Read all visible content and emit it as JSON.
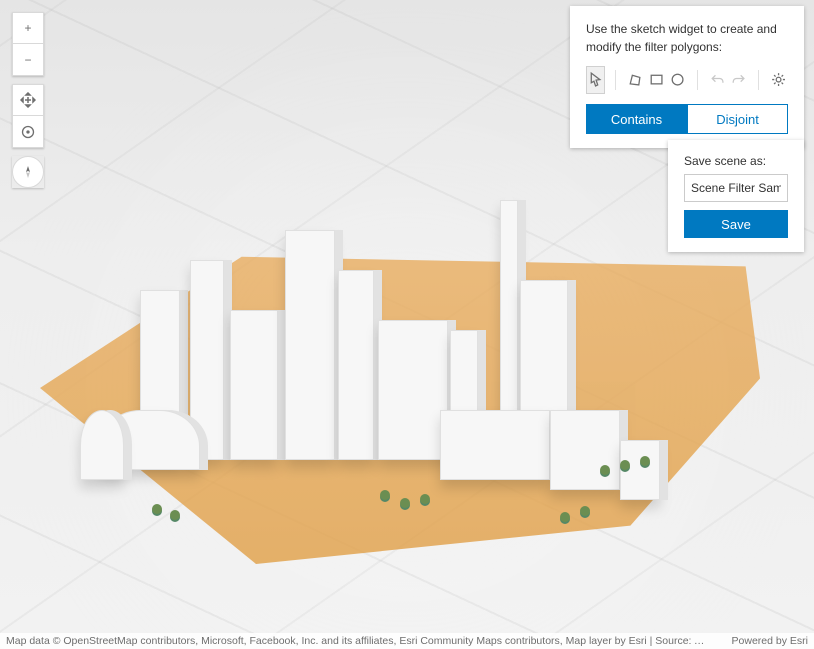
{
  "nav": {
    "zoom_in": "+",
    "zoom_out": "−"
  },
  "sketch": {
    "instruction": "Use the sketch widget to create and modify the filter polygons:",
    "tools": {
      "pointer": "pointer",
      "polygon": "polygon",
      "rectangle": "rectangle",
      "circle": "circle",
      "undo": "undo",
      "redo": "redo",
      "settings": "settings"
    },
    "modes": {
      "contains": "Contains",
      "disjoint": "Disjoint",
      "active": "contains"
    }
  },
  "save": {
    "label": "Save scene as:",
    "value": "Scene Filter Sample",
    "button": "Save"
  },
  "attribution": {
    "left": "Map data © OpenStreetMap contributors, Microsoft, Facebook, Inc. and its affiliates, Esri Community Maps contributors, Map layer by Esri | Source: Airbus,USGS,NGA,NASA,C…",
    "right": "Powered by Esri"
  },
  "colors": {
    "accent": "#0079c1",
    "polygon_fill": "#e1a44f",
    "polygon_stroke": "#e67e22"
  }
}
